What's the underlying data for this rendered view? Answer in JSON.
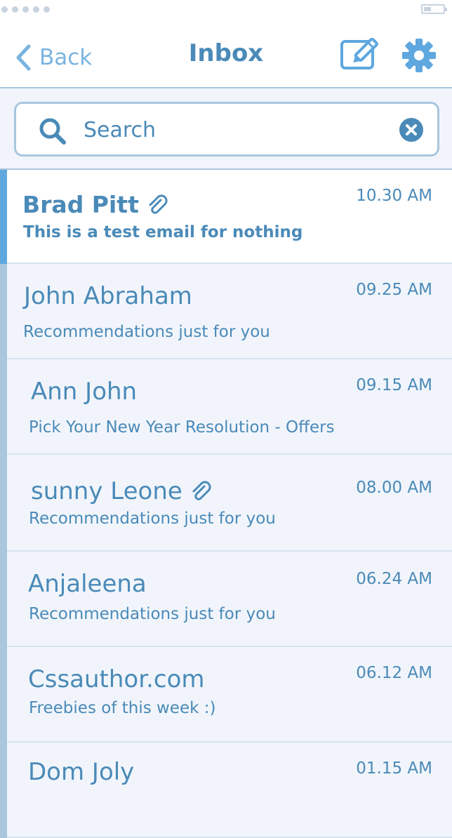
{
  "nav": {
    "back_label": "Back",
    "title": "Inbox",
    "compose_icon": "compose-icon",
    "settings_icon": "gear-icon"
  },
  "search": {
    "placeholder": "Search",
    "value": ""
  },
  "colors": {
    "accent": "#4a8ab8",
    "light_accent": "#7bb4e0",
    "selected_bar": "#5fa7df",
    "unselected_bar": "#a9c6df",
    "background": "#f1f5fb"
  },
  "emails": [
    {
      "sender": "Brad Pitt",
      "subject": "This is a test email for nothing",
      "time": "10.30 AM",
      "attachment": true,
      "selected": true
    },
    {
      "sender": "John Abraham",
      "subject": "Recommendations just for you",
      "time": "09.25 AM",
      "attachment": false,
      "selected": false
    },
    {
      "sender": "Ann John",
      "subject": "Pick Your New Year Resolution - Offers",
      "time": "09.15 AM",
      "attachment": false,
      "selected": false
    },
    {
      "sender": "sunny Leone",
      "subject": "Recommendations just for you",
      "time": "08.00 AM",
      "attachment": true,
      "selected": false
    },
    {
      "sender": "Anjaleena",
      "subject": "Recommendations just for you",
      "time": "06.24 AM",
      "attachment": false,
      "selected": false
    },
    {
      "sender": "Cssauthor.com",
      "subject": "Freebies of this week :)",
      "time": "06.12 AM",
      "attachment": false,
      "selected": false
    },
    {
      "sender": "Dom Joly",
      "subject": "",
      "time": "01.15 AM",
      "attachment": false,
      "selected": false
    }
  ]
}
